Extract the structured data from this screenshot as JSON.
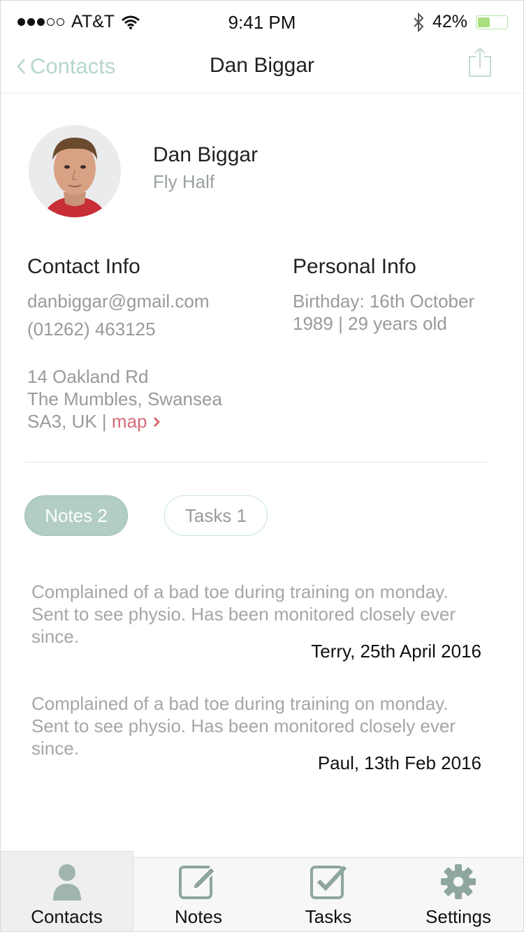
{
  "status_bar": {
    "carrier": "AT&T",
    "time": "9:41 PM",
    "battery_percent": "42%",
    "battery_level": 0.42,
    "signal_bars_filled": 3,
    "signal_bars_total": 5
  },
  "nav": {
    "back_label": "Contacts",
    "title": "Dan Biggar",
    "share_icon": "share-icon"
  },
  "profile": {
    "name": "Dan Biggar",
    "role": "Fly Half"
  },
  "contact_info": {
    "heading": "Contact Info",
    "email": "danbiggar@gmail.com",
    "phone": "(01262) 463125",
    "address_line1": "14 Oakland Rd",
    "address_line2": "The Mumbles, Swansea",
    "address_line3": "SA3, UK | ",
    "map_link": "map"
  },
  "personal_info": {
    "heading": "Personal Info",
    "birthday_line1": "Birthday: 16th October",
    "birthday_line2": "1989 | 29 years old"
  },
  "tabs": [
    {
      "label": "Notes 2",
      "active": true
    },
    {
      "label": "Tasks 1",
      "active": false
    }
  ],
  "notes": [
    {
      "text": "Complained of a bad toe during training on monday. Sent to see physio. Has been monitored closely ever since.",
      "author_date": "Terry, 25th April 2016"
    },
    {
      "text": "Complained of a bad toe during training on monday. Sent to see physio. Has been monitored closely ever since.",
      "author_date": "Paul, 13th Feb 2016"
    }
  ],
  "tab_bar": [
    {
      "label": "Contacts",
      "icon": "person-icon",
      "selected": true
    },
    {
      "label": "Notes",
      "icon": "edit-icon",
      "selected": false
    },
    {
      "label": "Tasks",
      "icon": "checkbox-icon",
      "selected": false
    },
    {
      "label": "Settings",
      "icon": "gear-icon",
      "selected": false
    }
  ],
  "colors": {
    "accent": "#b2cdc5",
    "link": "#d76b78",
    "back": "#b6d6cc",
    "battery": "#a8e07f"
  }
}
